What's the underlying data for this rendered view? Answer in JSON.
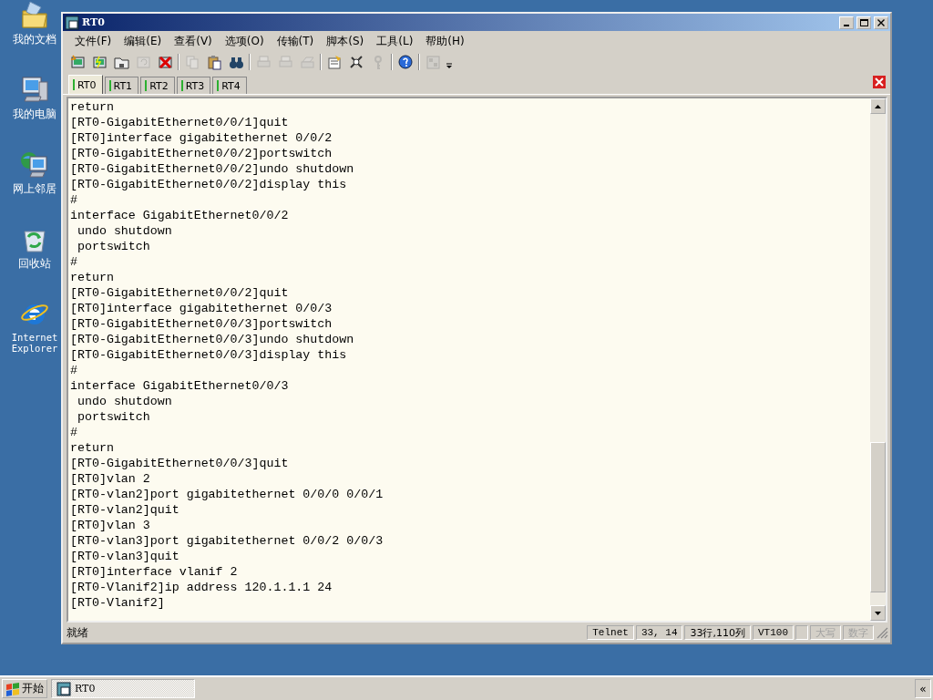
{
  "desktop_icons": [
    {
      "label": "我的文档"
    },
    {
      "label": "我的电脑"
    },
    {
      "label": "网上邻居"
    },
    {
      "label": "回收站"
    },
    {
      "label": "Internet Explorer"
    }
  ],
  "window": {
    "title": "RT0"
  },
  "menu": [
    "文件(F)",
    "编辑(E)",
    "查看(V)",
    "选项(O)",
    "传输(T)",
    "脚本(S)",
    "工具(L)",
    "帮助(H)"
  ],
  "toolbar": [
    {
      "kind": "tool",
      "disabled": false
    },
    {
      "kind": "tool",
      "disabled": false
    },
    {
      "kind": "tool",
      "disabled": false
    },
    {
      "kind": "tool",
      "disabled": true
    },
    {
      "kind": "tool",
      "disabled": false
    },
    {
      "kind": "separator"
    },
    {
      "kind": "tool",
      "disabled": true
    },
    {
      "kind": "tool",
      "disabled": false
    },
    {
      "kind": "tool",
      "disabled": false
    },
    {
      "kind": "separator"
    },
    {
      "kind": "tool",
      "disabled": true
    },
    {
      "kind": "tool",
      "disabled": true
    },
    {
      "kind": "tool",
      "disabled": true
    },
    {
      "kind": "separator"
    },
    {
      "kind": "tool",
      "disabled": false
    },
    {
      "kind": "tool",
      "disabled": false
    },
    {
      "kind": "tool",
      "disabled": true
    },
    {
      "kind": "separator"
    },
    {
      "kind": "tool",
      "disabled": false
    },
    {
      "kind": "separator"
    },
    {
      "kind": "tool",
      "disabled": true
    }
  ],
  "tabs": [
    {
      "label": "RT0",
      "selected": true
    },
    {
      "label": "RT1",
      "selected": false
    },
    {
      "label": "RT2",
      "selected": false
    },
    {
      "label": "RT3",
      "selected": false
    },
    {
      "label": "RT4",
      "selected": false
    }
  ],
  "terminal": {
    "lines": [
      "return",
      "[RT0-GigabitEthernet0/0/1]quit",
      "[RT0]interface gigabitethernet 0/0/2",
      "[RT0-GigabitEthernet0/0/2]portswitch",
      "[RT0-GigabitEthernet0/0/2]undo shutdown",
      "[RT0-GigabitEthernet0/0/2]display this",
      "#",
      "interface GigabitEthernet0/0/2",
      " undo shutdown",
      " portswitch",
      "#",
      "return",
      "[RT0-GigabitEthernet0/0/2]quit",
      "[RT0]interface gigabitethernet 0/0/3",
      "[RT0-GigabitEthernet0/0/3]portswitch",
      "[RT0-GigabitEthernet0/0/3]undo shutdown",
      "[RT0-GigabitEthernet0/0/3]display this",
      "#",
      "interface GigabitEthernet0/0/3",
      " undo shutdown",
      " portswitch",
      "#",
      "return",
      "[RT0-GigabitEthernet0/0/3]quit",
      "[RT0]vlan 2",
      "[RT0-vlan2]port gigabitethernet 0/0/0 0/0/1",
      "[RT0-vlan2]quit",
      "[RT0]vlan 3",
      "[RT0-vlan3]port gigabitethernet 0/0/2 0/0/3",
      "[RT0-vlan3]quit",
      "[RT0]interface vlanif 2",
      "[RT0-Vlanif2]ip address 120.1.1.1 24",
      "[RT0-Vlanif2]"
    ]
  },
  "status_bar": {
    "message": "就绪",
    "panels": [
      {
        "text": "Telnet",
        "disabled": false
      },
      {
        "text": "33,  14",
        "disabled": false
      },
      {
        "text": "33行,110列",
        "disabled": false
      },
      {
        "text": "VT100",
        "disabled": false
      },
      {
        "text": "大写",
        "disabled": true
      },
      {
        "text": "数字",
        "disabled": true
      }
    ]
  },
  "taskbar": {
    "start": "开始",
    "tasks": [
      {
        "label": "RT0",
        "selected": true
      }
    ],
    "tray_button": "«"
  }
}
